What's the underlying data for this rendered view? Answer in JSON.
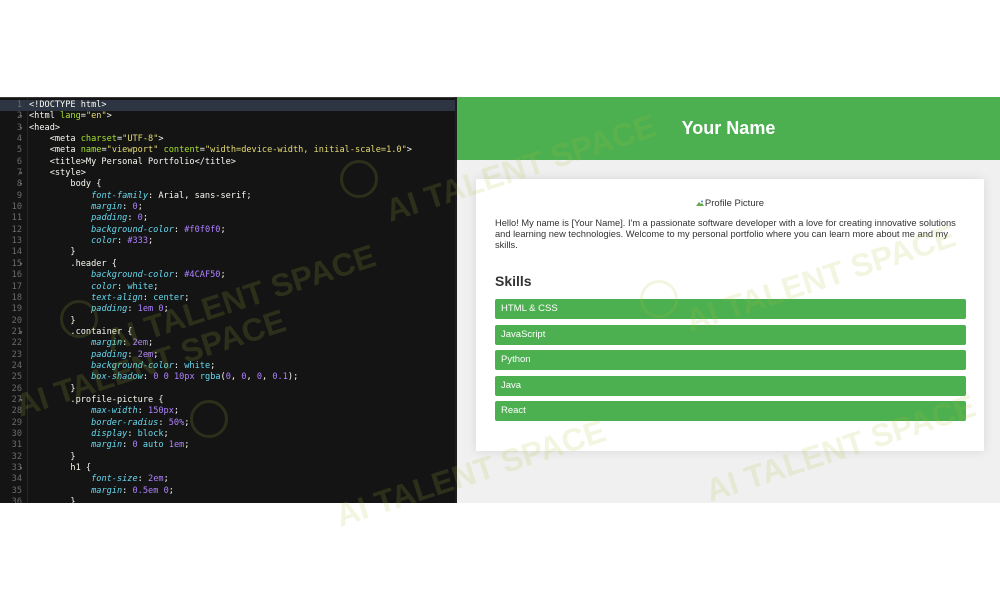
{
  "editor": {
    "lines": [
      {
        "n": "1",
        "fold": "",
        "html": "<span class=\"t-tag\">&lt;!DOCTYPE html&gt;</span>"
      },
      {
        "n": "2",
        "fold": "▾",
        "html": "<span class=\"t-tag\">&lt;html </span><span class=\"t-attr\">lang</span>=<span class=\"t-str\">\"en\"</span>&gt;"
      },
      {
        "n": "3",
        "fold": "▾",
        "html": "<span class=\"t-tag\">&lt;head&gt;</span>"
      },
      {
        "n": "4",
        "fold": "",
        "html": "    &lt;meta <span class=\"t-attr\">charset</span>=<span class=\"t-str\">\"UTF-8\"</span>&gt;"
      },
      {
        "n": "5",
        "fold": "",
        "html": "    &lt;meta <span class=\"t-attr\">name</span>=<span class=\"t-str\">\"viewport\"</span> <span class=\"t-attr\">content</span>=<span class=\"t-str\">\"width=device-width, initial-scale=1.0\"</span>&gt;"
      },
      {
        "n": "6",
        "fold": "",
        "html": "    &lt;title&gt;My Personal Portfolio&lt;/title&gt;"
      },
      {
        "n": "7",
        "fold": "▾",
        "html": "    &lt;style&gt;"
      },
      {
        "n": "8",
        "fold": "▾",
        "html": "        body {"
      },
      {
        "n": "9",
        "fold": "",
        "html": "            <span class=\"t-prop\">font-family</span>: Arial, sans-serif;"
      },
      {
        "n": "10",
        "fold": "",
        "html": "            <span class=\"t-prop\">margin</span>: <span class=\"t-num\">0</span>;"
      },
      {
        "n": "11",
        "fold": "",
        "html": "            <span class=\"t-prop\">padding</span>: <span class=\"t-num\">0</span>;"
      },
      {
        "n": "12",
        "fold": "",
        "html": "            <span class=\"t-prop\">background-color</span>: <span class=\"t-num\">#f0f0f0</span>;"
      },
      {
        "n": "13",
        "fold": "",
        "html": "            <span class=\"t-prop\">color</span>: <span class=\"t-num\">#333</span>;"
      },
      {
        "n": "14",
        "fold": "",
        "html": "        }"
      },
      {
        "n": "15",
        "fold": "▾",
        "html": "        .header {"
      },
      {
        "n": "16",
        "fold": "",
        "html": "            <span class=\"t-prop\">background-color</span>: <span class=\"t-num\">#4CAF50</span>;"
      },
      {
        "n": "17",
        "fold": "",
        "html": "            <span class=\"t-prop\">color</span>: <span class=\"t-kw\">white</span>;"
      },
      {
        "n": "18",
        "fold": "",
        "html": "            <span class=\"t-prop\">text-align</span>: <span class=\"t-kw\">center</span>;"
      },
      {
        "n": "19",
        "fold": "",
        "html": "            <span class=\"t-prop\">padding</span>: <span class=\"t-num\">1em</span> <span class=\"t-num\">0</span>;"
      },
      {
        "n": "20",
        "fold": "",
        "html": "        }"
      },
      {
        "n": "21",
        "fold": "▾",
        "html": "        .container {"
      },
      {
        "n": "22",
        "fold": "",
        "html": "            <span class=\"t-prop\">margin</span>: <span class=\"t-num\">2em</span>;"
      },
      {
        "n": "23",
        "fold": "",
        "html": "            <span class=\"t-prop\">padding</span>: <span class=\"t-num\">2em</span>;"
      },
      {
        "n": "24",
        "fold": "",
        "html": "            <span class=\"t-prop\">background-color</span>: <span class=\"t-kw\">white</span>;"
      },
      {
        "n": "25",
        "fold": "",
        "html": "            <span class=\"t-prop\">box-shadow</span>: <span class=\"t-num\">0</span> <span class=\"t-num\">0</span> <span class=\"t-num\">10px</span> <span class=\"t-kw\">rgba</span>(<span class=\"t-num\">0</span>, <span class=\"t-num\">0</span>, <span class=\"t-num\">0</span>, <span class=\"t-num\">0.1</span>);"
      },
      {
        "n": "26",
        "fold": "",
        "html": "        }"
      },
      {
        "n": "27",
        "fold": "▾",
        "html": "        .profile-picture {"
      },
      {
        "n": "28",
        "fold": "",
        "html": "            <span class=\"t-prop\">max-width</span>: <span class=\"t-num\">150px</span>;"
      },
      {
        "n": "29",
        "fold": "",
        "html": "            <span class=\"t-prop\">border-radius</span>: <span class=\"t-num\">50%</span>;"
      },
      {
        "n": "30",
        "fold": "",
        "html": "            <span class=\"t-prop\">display</span>: <span class=\"t-kw\">block</span>;"
      },
      {
        "n": "31",
        "fold": "",
        "html": "            <span class=\"t-prop\">margin</span>: <span class=\"t-num\">0</span> <span class=\"t-kw\">auto</span> <span class=\"t-num\">1em</span>;"
      },
      {
        "n": "32",
        "fold": "",
        "html": "        }"
      },
      {
        "n": "33",
        "fold": "▾",
        "html": "        h1 {"
      },
      {
        "n": "34",
        "fold": "",
        "html": "            <span class=\"t-prop\">font-size</span>: <span class=\"t-num\">2em</span>;"
      },
      {
        "n": "35",
        "fold": "",
        "html": "            <span class=\"t-prop\">margin</span>: <span class=\"t-num\">0.5em</span> <span class=\"t-num\">0</span>;"
      },
      {
        "n": "36",
        "fold": "",
        "html": "        }"
      }
    ]
  },
  "preview": {
    "header_title": "Your Name",
    "profile_picture_alt": "Profile Picture",
    "intro": "Hello! My name is [Your Name]. I'm a passionate software developer with a love for creating innovative solutions and learning new technologies. Welcome to my personal portfolio where you can learn more about me and my skills.",
    "skills_title": "Skills",
    "skills": [
      "HTML & CSS",
      "JavaScript",
      "Python",
      "Java",
      "React"
    ]
  },
  "watermark": {
    "text": "AI TALENT SPACE"
  },
  "colors": {
    "accent": "#4caf50",
    "editor_bg": "#141414",
    "preview_bg": "#f0f0f0"
  }
}
